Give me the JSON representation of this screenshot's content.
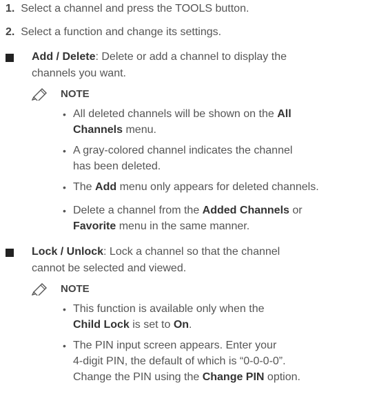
{
  "steps": [
    {
      "num": "1.",
      "pre": "Select a channel and press the ",
      "kw": "TOOLS",
      "post": " button."
    },
    {
      "num": "2.",
      "text": "Select a function and change its settings."
    }
  ],
  "add_delete": {
    "title": "Add / Delete",
    "line1": ": Delete or add a channel to display the",
    "line2": "channels you want.",
    "note_label": "NOTE",
    "b1_pre": "All deleted channels will be shown on the ",
    "b1_bold1": "All",
    "b1_bold2": "Channels",
    "b1_post": " menu.",
    "b2_l1": "A gray-colored channel indicates the channel",
    "b2_l2": "has been deleted.",
    "b3_pre": "The ",
    "b3_bold": "Add",
    "b3_post": " menu only appears for deleted channels.",
    "b4_pre": "Delete a channel from the ",
    "b4_bold1": "Added Channels",
    "b4_mid": " or",
    "b4_bold2": "Favorite",
    "b4_post": " menu in the same manner."
  },
  "lock_unlock": {
    "title": "Lock / Unlock",
    "line1": ": Lock a channel so that the channel",
    "line2": "cannot be selected and viewed.",
    "note_label": "NOTE",
    "b1_l1": "This function is available only when the",
    "b1_bold1": "Child Lock",
    "b1_mid": " is set to ",
    "b1_bold2": "On",
    "b1_post": ".",
    "b2_l1": "The PIN input screen appears. Enter your",
    "b2_l2": "4-digit PIN, the default of which is “0-0-0-0”.",
    "b2_pre": "Change the PIN using the ",
    "b2_bold": "Change PIN",
    "b2_post": " option."
  }
}
